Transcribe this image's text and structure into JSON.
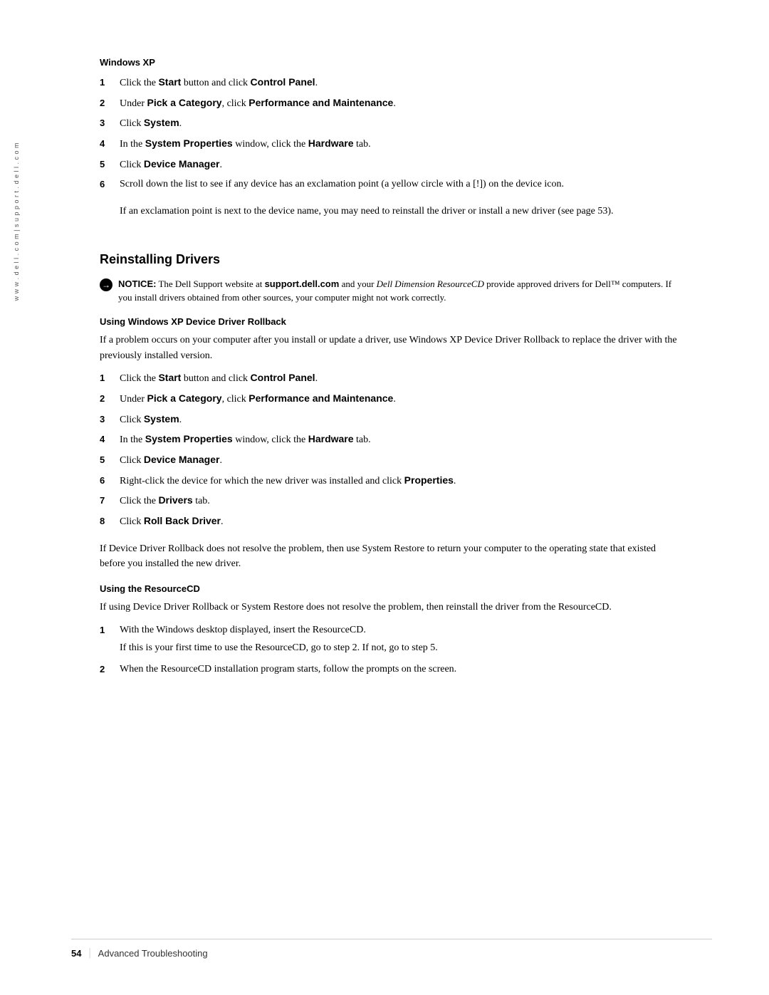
{
  "sidebar": {
    "text": "w w w . d e l l . c o m   |   s u p p o r t . d e l l . c o m"
  },
  "windows_xp_section": {
    "heading": "Windows XP",
    "steps": [
      {
        "num": "1",
        "text_before": "Click the ",
        "bold1": "Start",
        "text_mid1": " button and click ",
        "bold2": "Control Panel",
        "text_after": "."
      },
      {
        "num": "2",
        "text_before": "Under ",
        "bold1": "Pick a Category",
        "text_mid1": ", click ",
        "bold2": "Performance and Maintenance",
        "text_after": "."
      },
      {
        "num": "3",
        "text_before": "Click ",
        "bold1": "System",
        "text_after": "."
      },
      {
        "num": "4",
        "text_before": "In the ",
        "bold1": "System Properties",
        "text_mid1": " window, click the ",
        "bold2": "Hardware",
        "text_after": " tab."
      },
      {
        "num": "5",
        "text_before": "Click ",
        "bold1": "Device Manager",
        "text_after": "."
      },
      {
        "num": "6",
        "text_before": "Scroll down the list to see if any device has an exclamation point (a yellow circle with a [!]) on the device icon."
      }
    ],
    "note_para": "If an exclamation point is next to the device name, you may need to reinstall the driver or install a new driver (see page 53)."
  },
  "reinstalling_drivers": {
    "heading": "Reinstalling Drivers",
    "notice_label": "NOTICE:",
    "notice_text": "The Dell Support website at ",
    "notice_bold1": "support.dell.com",
    "notice_text2": " and your ",
    "notice_italic": "Dell Dimension ResourceCD",
    "notice_text3": " provide approved drivers for Dell™ computers. If you install drivers obtained from other sources, your computer might not work correctly.",
    "rollback_heading": "Using Windows XP Device Driver Rollback",
    "rollback_intro": "If a problem occurs on your computer after you install or update a driver, use Windows XP Device Driver Rollback to replace the driver with the previously installed version.",
    "rollback_steps": [
      {
        "num": "1",
        "text_before": "Click the ",
        "bold1": "Start",
        "text_mid1": " button and click ",
        "bold2": "Control Panel",
        "text_after": "."
      },
      {
        "num": "2",
        "text_before": "Under ",
        "bold1": "Pick a Category",
        "text_mid1": ", click ",
        "bold2": "Performance and Maintenance",
        "text_after": "."
      },
      {
        "num": "3",
        "text_before": "Click ",
        "bold1": "System",
        "text_after": "."
      },
      {
        "num": "4",
        "text_before": "In the ",
        "bold1": "System Properties",
        "text_mid1": " window, click the ",
        "bold2": "Hardware",
        "text_after": " tab."
      },
      {
        "num": "5",
        "text_before": "Click ",
        "bold1": "Device Manager",
        "text_after": "."
      },
      {
        "num": "6",
        "text_before": "Right-click the device for which the new driver was installed and click ",
        "bold1": "Properties",
        "text_after": "."
      },
      {
        "num": "7",
        "text_before": "Click the ",
        "bold1": "Drivers",
        "text_after": " tab."
      },
      {
        "num": "8",
        "text_before": "Click ",
        "bold1": "Roll Back Driver",
        "text_after": "."
      }
    ],
    "rollback_outro": "If Device Driver Rollback does not resolve the problem, then use System Restore to return your computer to the operating state that existed before you installed the new driver.",
    "resourcecd_heading": "Using the ResourceCD",
    "resourcecd_intro": "If using Device Driver Rollback or System Restore does not resolve the problem, then reinstall the driver from the ResourceCD.",
    "resourcecd_steps": [
      {
        "num": "1",
        "text": "With the Windows desktop displayed, insert the ResourceCD.",
        "sub_text": "If this is your first time to use the ResourceCD, go to step 2. If not, go to step 5."
      },
      {
        "num": "2",
        "text": "When the ResourceCD installation program starts, follow the prompts on the screen."
      }
    ]
  },
  "footer": {
    "page_number": "54",
    "separator": "|",
    "section_text": "Advanced Troubleshooting"
  }
}
